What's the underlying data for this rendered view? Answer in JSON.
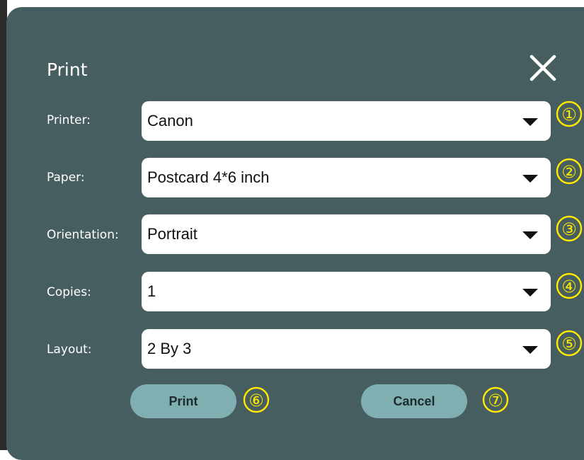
{
  "dialog": {
    "title": "Print",
    "close_icon": "close-icon"
  },
  "fields": [
    {
      "label": "Printer:",
      "value": "Canon",
      "marker": "①"
    },
    {
      "label": "Paper:",
      "value": "Postcard 4*6 inch",
      "marker": "②"
    },
    {
      "label": "Orientation:",
      "value": "Portrait",
      "marker": "③"
    },
    {
      "label": "Copies:",
      "value": "1",
      "marker": "④"
    },
    {
      "label": "Layout:",
      "value": "2 By 3",
      "marker": "⑤"
    }
  ],
  "buttons": {
    "print_label": "Print",
    "print_marker": "⑥",
    "cancel_label": "Cancel",
    "cancel_marker": "⑦"
  },
  "colors": {
    "dialog_bg": "#475e60",
    "button_bg": "#7fafb1",
    "marker": "#ffea00"
  }
}
